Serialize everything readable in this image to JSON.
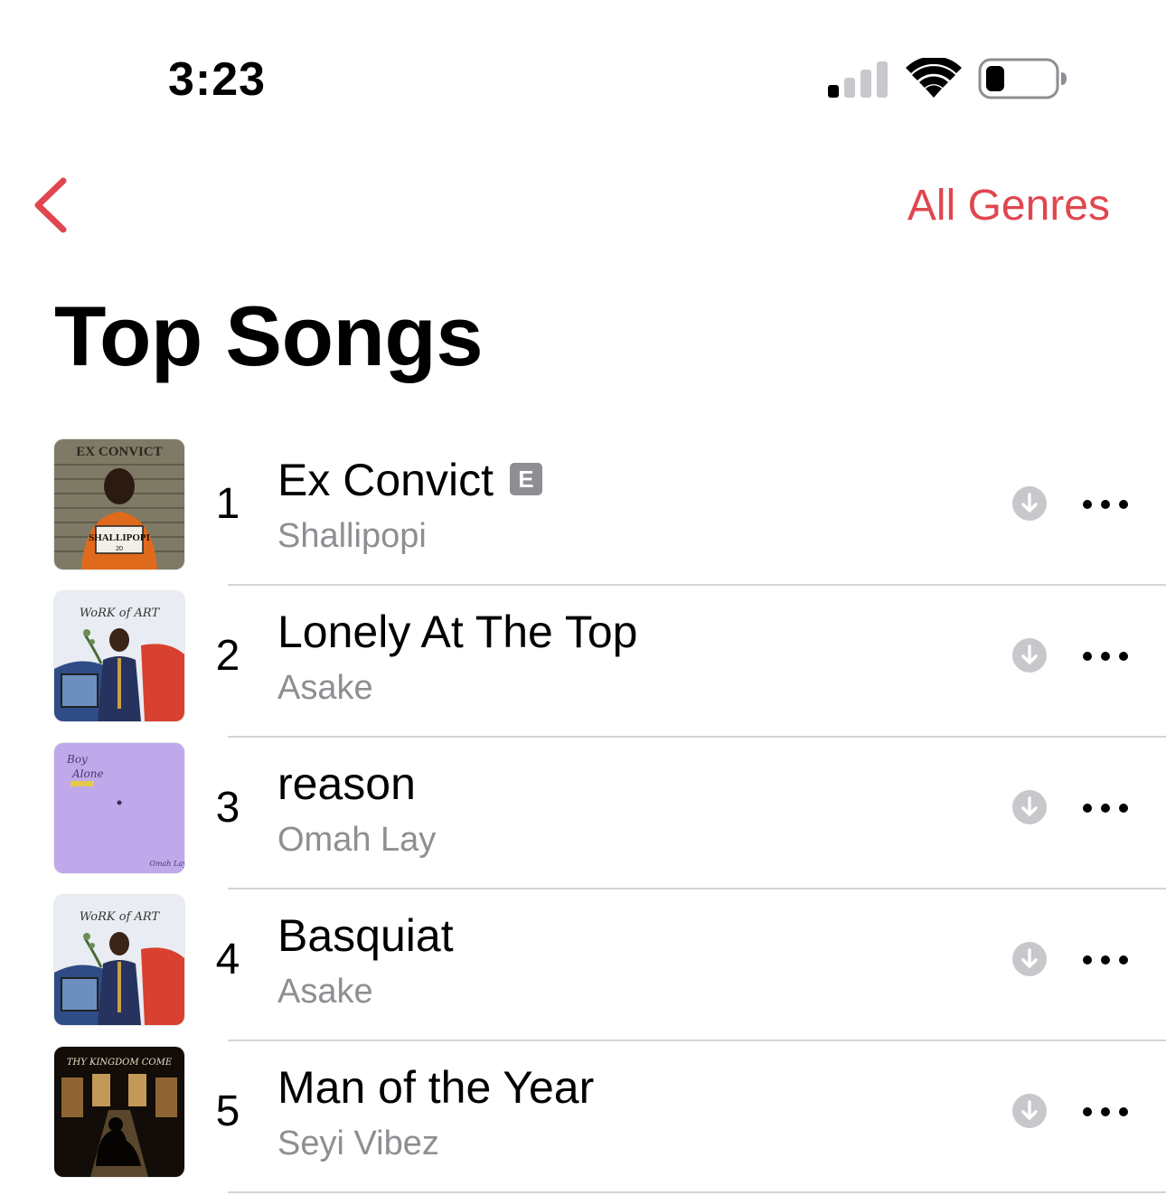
{
  "status_bar": {
    "time": "3:23",
    "signal_icon": "cellular-signal-icon",
    "wifi_icon": "wifi-icon",
    "battery_icon": "battery-icon"
  },
  "nav": {
    "back_icon": "chevron-left-icon",
    "genres_label": "All Genres"
  },
  "page": {
    "title": "Top Songs"
  },
  "colors": {
    "accent": "#e0464f",
    "secondary_text": "#8e8e93",
    "download_icon_bg": "#c7c7cc"
  },
  "songs": [
    {
      "rank": "1",
      "title": "Ex Convict",
      "artist": "Shallipopi",
      "explicit": true,
      "explicit_label": "E",
      "artwork": "ex-convict-artwork"
    },
    {
      "rank": "2",
      "title": "Lonely At The Top",
      "artist": "Asake",
      "explicit": false,
      "artwork": "work-of-art-artwork"
    },
    {
      "rank": "3",
      "title": "reason",
      "artist": "Omah Lay",
      "explicit": false,
      "artwork": "boy-alone-artwork"
    },
    {
      "rank": "4",
      "title": "Basquiat",
      "artist": "Asake",
      "explicit": false,
      "artwork": "work-of-art-artwork"
    },
    {
      "rank": "5",
      "title": "Man of the Year",
      "artist": "Seyi Vibez",
      "explicit": false,
      "artwork": "thy-kingdom-come-artwork"
    }
  ]
}
